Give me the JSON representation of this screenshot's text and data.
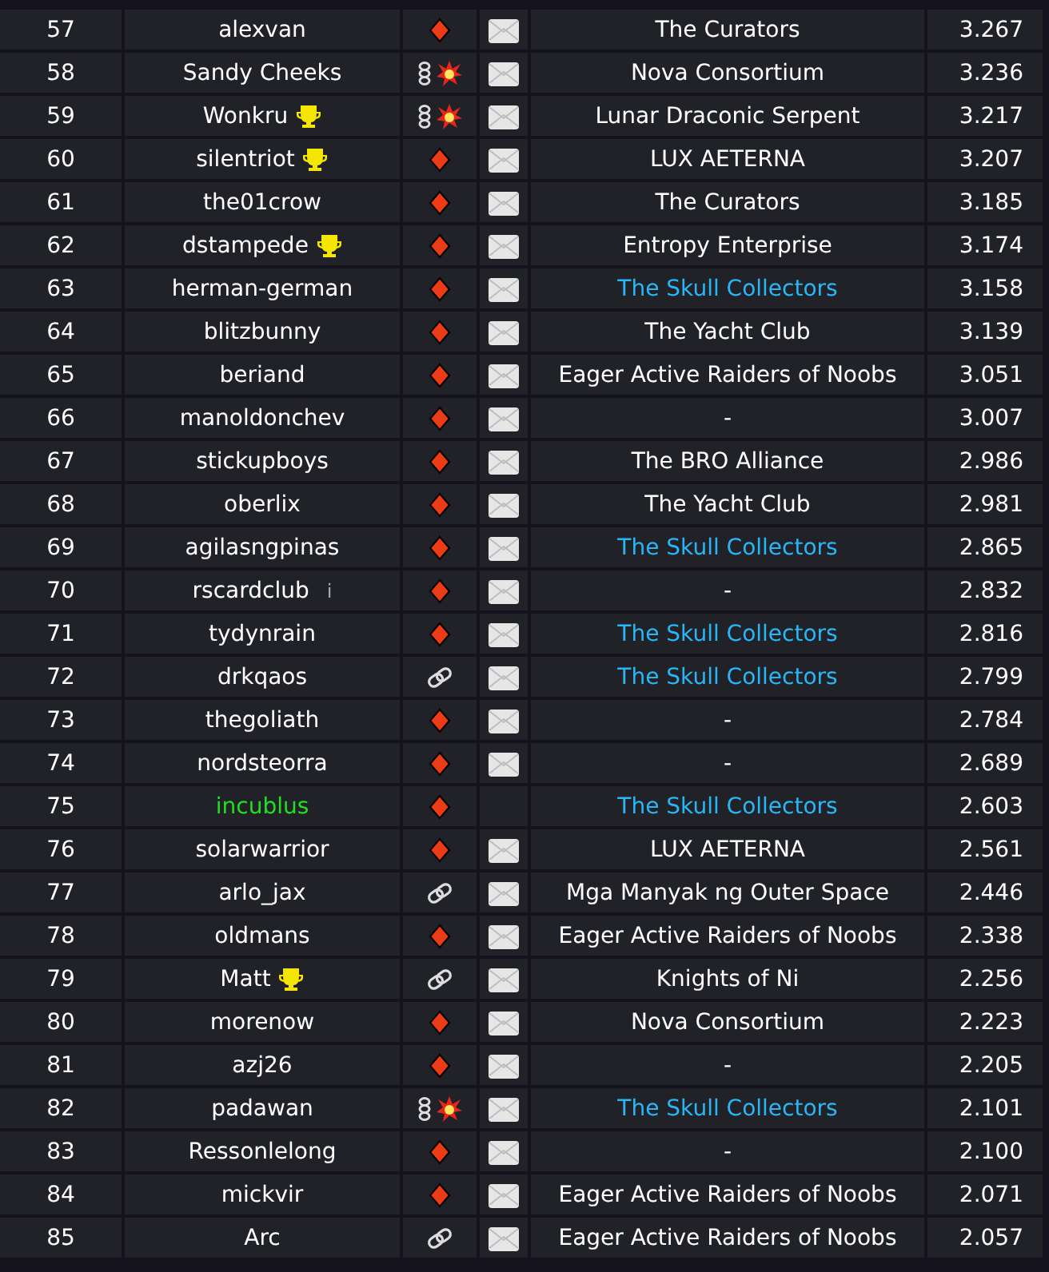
{
  "rows": [
    {
      "rank": "57",
      "player": {
        "name": "alexvan",
        "color": "#ffffff",
        "trophy": false
      },
      "status": {
        "kind": "diamond"
      },
      "mail": true,
      "alliance": {
        "name": "The Curators",
        "color": "#ffffff"
      },
      "score": "3.267"
    },
    {
      "rank": "58",
      "player": {
        "name": "Sandy Cheeks",
        "color": "#ffffff",
        "trophy": false
      },
      "status": {
        "kind": "chain-boom"
      },
      "mail": true,
      "alliance": {
        "name": "Nova Consortium",
        "color": "#ffffff"
      },
      "score": "3.236"
    },
    {
      "rank": "59",
      "player": {
        "name": "Wonkru",
        "color": "#ffffff",
        "trophy": true
      },
      "status": {
        "kind": "chain-boom"
      },
      "mail": true,
      "alliance": {
        "name": "Lunar Draconic Serpent",
        "color": "#ffffff"
      },
      "score": "3.217"
    },
    {
      "rank": "60",
      "player": {
        "name": "silentriot",
        "color": "#ffffff",
        "trophy": true
      },
      "status": {
        "kind": "diamond"
      },
      "mail": true,
      "alliance": {
        "name": "LUX AETERNA",
        "color": "#ffffff"
      },
      "score": "3.207"
    },
    {
      "rank": "61",
      "player": {
        "name": "the01crow",
        "color": "#ffffff",
        "trophy": false
      },
      "status": {
        "kind": "diamond"
      },
      "mail": true,
      "alliance": {
        "name": "The Curators",
        "color": "#ffffff"
      },
      "score": "3.185"
    },
    {
      "rank": "62",
      "player": {
        "name": "dstampede",
        "color": "#ffffff",
        "trophy": true
      },
      "status": {
        "kind": "diamond"
      },
      "mail": true,
      "alliance": {
        "name": "Entropy Enterprise",
        "color": "#ffffff"
      },
      "score": "3.174"
    },
    {
      "rank": "63",
      "player": {
        "name": "herman-german",
        "color": "#ffffff",
        "trophy": false
      },
      "status": {
        "kind": "diamond"
      },
      "mail": true,
      "alliance": {
        "name": "The Skull Collectors",
        "color": "#29b6f6"
      },
      "score": "3.158"
    },
    {
      "rank": "64",
      "player": {
        "name": "blitzbunny",
        "color": "#ffffff",
        "trophy": false
      },
      "status": {
        "kind": "diamond"
      },
      "mail": true,
      "alliance": {
        "name": "The Yacht Club",
        "color": "#ffffff"
      },
      "score": "3.139"
    },
    {
      "rank": "65",
      "player": {
        "name": "beriand",
        "color": "#ffffff",
        "trophy": false
      },
      "status": {
        "kind": "diamond"
      },
      "mail": true,
      "alliance": {
        "name": "Eager Active Raiders of Noobs",
        "color": "#ffffff"
      },
      "score": "3.051"
    },
    {
      "rank": "66",
      "player": {
        "name": "manoldonchev",
        "color": "#ffffff",
        "trophy": false
      },
      "status": {
        "kind": "diamond"
      },
      "mail": true,
      "alliance": {
        "name": "-",
        "color": "#ffffff"
      },
      "score": "3.007"
    },
    {
      "rank": "67",
      "player": {
        "name": "stickupboys",
        "color": "#ffffff",
        "trophy": false
      },
      "status": {
        "kind": "diamond"
      },
      "mail": true,
      "alliance": {
        "name": "The BRO Alliance",
        "color": "#ffffff"
      },
      "score": "2.986"
    },
    {
      "rank": "68",
      "player": {
        "name": "oberlix",
        "color": "#ffffff",
        "trophy": false
      },
      "status": {
        "kind": "diamond"
      },
      "mail": true,
      "alliance": {
        "name": "The Yacht Club",
        "color": "#ffffff"
      },
      "score": "2.981"
    },
    {
      "rank": "69",
      "player": {
        "name": "agilasngpinas",
        "color": "#ffffff",
        "trophy": false
      },
      "status": {
        "kind": "diamond"
      },
      "mail": true,
      "alliance": {
        "name": "The Skull Collectors",
        "color": "#29b6f6"
      },
      "score": "2.865"
    },
    {
      "rank": "70",
      "player": {
        "name": "rscardclub",
        "color": "#ffffff",
        "trophy": false,
        "note": "i"
      },
      "status": {
        "kind": "diamond"
      },
      "mail": true,
      "alliance": {
        "name": "-",
        "color": "#ffffff"
      },
      "score": "2.832"
    },
    {
      "rank": "71",
      "player": {
        "name": "tydynrain",
        "color": "#ffffff",
        "trophy": false
      },
      "status": {
        "kind": "diamond"
      },
      "mail": true,
      "alliance": {
        "name": "The Skull Collectors",
        "color": "#29b6f6"
      },
      "score": "2.816"
    },
    {
      "rank": "72",
      "player": {
        "name": "drkqaos",
        "color": "#ffffff",
        "trophy": false
      },
      "status": {
        "kind": "link"
      },
      "mail": true,
      "alliance": {
        "name": "The Skull Collectors",
        "color": "#29b6f6"
      },
      "score": "2.799"
    },
    {
      "rank": "73",
      "player": {
        "name": "thegoliath",
        "color": "#ffffff",
        "trophy": false
      },
      "status": {
        "kind": "diamond"
      },
      "mail": true,
      "alliance": {
        "name": "-",
        "color": "#ffffff"
      },
      "score": "2.784"
    },
    {
      "rank": "74",
      "player": {
        "name": "nordsteorra",
        "color": "#ffffff",
        "trophy": false
      },
      "status": {
        "kind": "diamond"
      },
      "mail": true,
      "alliance": {
        "name": "-",
        "color": "#ffffff"
      },
      "score": "2.689"
    },
    {
      "rank": "75",
      "player": {
        "name": "incublus",
        "color": "#22dd22",
        "trophy": false
      },
      "status": {
        "kind": "diamond"
      },
      "mail": false,
      "alliance": {
        "name": "The Skull Collectors",
        "color": "#29b6f6"
      },
      "score": "2.603"
    },
    {
      "rank": "76",
      "player": {
        "name": "solarwarrior",
        "color": "#ffffff",
        "trophy": false
      },
      "status": {
        "kind": "diamond"
      },
      "mail": true,
      "alliance": {
        "name": "LUX AETERNA",
        "color": "#ffffff"
      },
      "score": "2.561"
    },
    {
      "rank": "77",
      "player": {
        "name": "arlo_jax",
        "color": "#ffffff",
        "trophy": false
      },
      "status": {
        "kind": "link"
      },
      "mail": true,
      "alliance": {
        "name": "Mga Manyak ng Outer Space",
        "color": "#ffffff"
      },
      "score": "2.446"
    },
    {
      "rank": "78",
      "player": {
        "name": "oldmans",
        "color": "#ffffff",
        "trophy": false
      },
      "status": {
        "kind": "diamond"
      },
      "mail": true,
      "alliance": {
        "name": "Eager Active Raiders of Noobs",
        "color": "#ffffff"
      },
      "score": "2.338"
    },
    {
      "rank": "79",
      "player": {
        "name": "Matt",
        "color": "#ffffff",
        "trophy": true
      },
      "status": {
        "kind": "link"
      },
      "mail": true,
      "alliance": {
        "name": "Knights of Ni",
        "color": "#ffffff"
      },
      "score": "2.256"
    },
    {
      "rank": "80",
      "player": {
        "name": "morenow",
        "color": "#ffffff",
        "trophy": false
      },
      "status": {
        "kind": "diamond"
      },
      "mail": true,
      "alliance": {
        "name": "Nova Consortium",
        "color": "#ffffff"
      },
      "score": "2.223"
    },
    {
      "rank": "81",
      "player": {
        "name": "azj26",
        "color": "#ffffff",
        "trophy": false
      },
      "status": {
        "kind": "diamond"
      },
      "mail": true,
      "alliance": {
        "name": "-",
        "color": "#ffffff"
      },
      "score": "2.205"
    },
    {
      "rank": "82",
      "player": {
        "name": "padawan",
        "color": "#ffffff",
        "trophy": false
      },
      "status": {
        "kind": "chain-boom"
      },
      "mail": true,
      "alliance": {
        "name": "The Skull Collectors",
        "color": "#29b6f6"
      },
      "score": "2.101"
    },
    {
      "rank": "83",
      "player": {
        "name": "Ressonlelong",
        "color": "#ffffff",
        "trophy": false
      },
      "status": {
        "kind": "diamond"
      },
      "mail": true,
      "alliance": {
        "name": "-",
        "color": "#ffffff"
      },
      "score": "2.100"
    },
    {
      "rank": "84",
      "player": {
        "name": "mickvir",
        "color": "#ffffff",
        "trophy": false
      },
      "status": {
        "kind": "diamond"
      },
      "mail": true,
      "alliance": {
        "name": "Eager Active Raiders of Noobs",
        "color": "#ffffff"
      },
      "score": "2.071"
    },
    {
      "rank": "85",
      "player": {
        "name": "Arc",
        "color": "#ffffff",
        "trophy": false
      },
      "status": {
        "kind": "link"
      },
      "mail": true,
      "alliance": {
        "name": "Eager Active Raiders of Noobs",
        "color": "#ffffff"
      },
      "score": "2.057"
    }
  ]
}
